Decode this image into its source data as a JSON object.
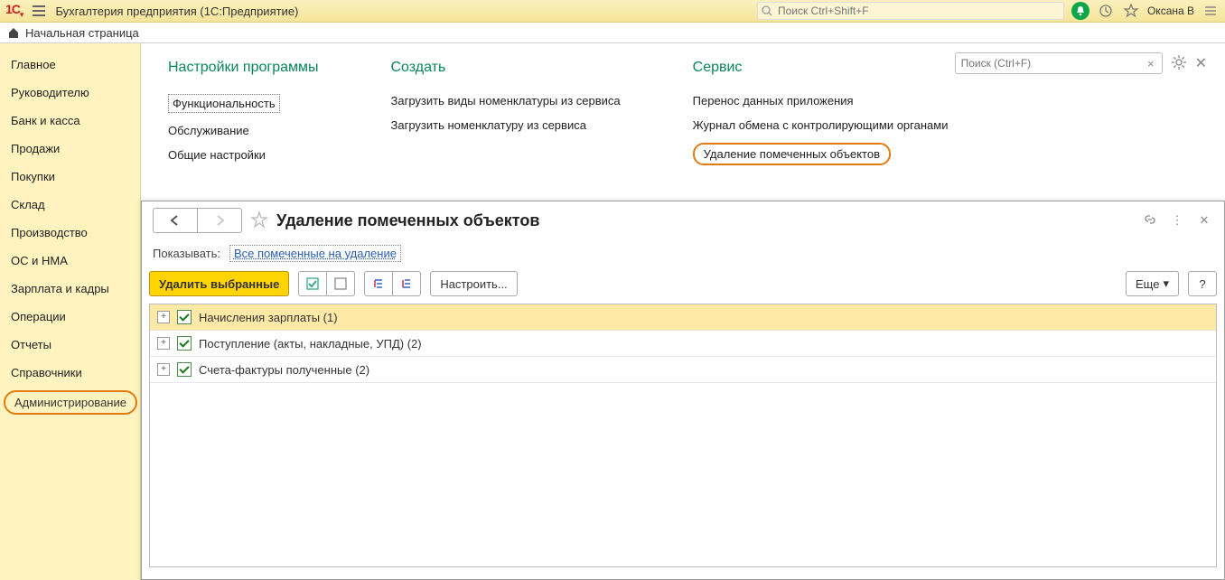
{
  "topbar": {
    "app_title": "Бухгалтерия предприятия  (1С:Предприятие)",
    "search_placeholder": "Поиск Ctrl+Shift+F",
    "user": "Оксана В"
  },
  "second_row": {
    "home_label": "Начальная страница"
  },
  "sidebar": {
    "items": [
      "Главное",
      "Руководителю",
      "Банк и касса",
      "Продажи",
      "Покупки",
      "Склад",
      "Производство",
      "ОС и НМА",
      "Зарплата и кадры",
      "Операции",
      "Отчеты",
      "Справочники",
      "Администрирование"
    ]
  },
  "bgpanel": {
    "search_placeholder": "Поиск (Ctrl+F)",
    "columns": [
      {
        "title": "Настройки программы",
        "links": [
          "Функциональность",
          "Обслуживание",
          "Общие настройки"
        ]
      },
      {
        "title": "Создать",
        "links": [
          "Загрузить виды номенклатуры из сервиса",
          "Загрузить номенклатуру из сервиса"
        ]
      },
      {
        "title": "Сервис",
        "links": [
          "Перенос данных приложения",
          "Журнал обмена с контролирующими органами",
          "Удаление помеченных объектов"
        ]
      }
    ]
  },
  "overlay": {
    "title": "Удаление помеченных объектов",
    "show_label": "Показывать:",
    "show_link": "Все помеченные на удаление",
    "delete_btn": "Удалить выбранные",
    "configure_btn": "Настроить...",
    "more_btn": "Еще",
    "help_btn": "?",
    "rows": [
      "Начисления зарплаты (1)",
      "Поступление (акты, накладные, УПД) (2)",
      "Счета-фактуры полученные (2)"
    ]
  }
}
